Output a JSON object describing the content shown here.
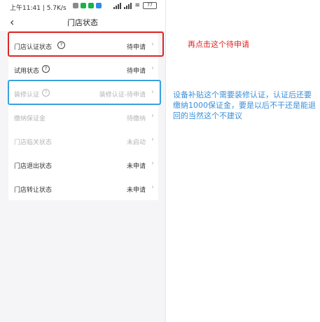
{
  "status_bar": {
    "time_speed": "上午11:41 | 5.7K/s",
    "network": "4G",
    "battery": "77"
  },
  "nav": {
    "back_icon": "chevron-left",
    "title": "门店状态"
  },
  "rows": [
    {
      "label": "门店认证状态",
      "value": "待申请",
      "has_help": true,
      "dimmed": false
    },
    {
      "label": "试用状态",
      "value": "待申请",
      "has_help": true,
      "dimmed": false
    },
    {
      "label": "装修认证",
      "value": "装修认证-待申请",
      "has_help": true,
      "dimmed": true
    },
    {
      "label": "缴纳保证金",
      "value": "待缴纳",
      "has_help": false,
      "dimmed": true
    },
    {
      "label": "门店临关状态",
      "value": "未启动",
      "has_help": false,
      "dimmed": true
    },
    {
      "label": "门店退出状态",
      "value": "未申请",
      "has_help": false,
      "dimmed": false
    },
    {
      "label": "门店转让状态",
      "value": "未申请",
      "has_help": false,
      "dimmed": false
    }
  ],
  "annotations": {
    "red_note": "再点击这个待申请",
    "blue_note": "设备补贴这个需要装修认证，认证后还要缴纳1000保证金，要是以后不干还是能退回的当然这个不建议",
    "red_color": "#e02424",
    "blue_color": "#3a8fd8"
  }
}
